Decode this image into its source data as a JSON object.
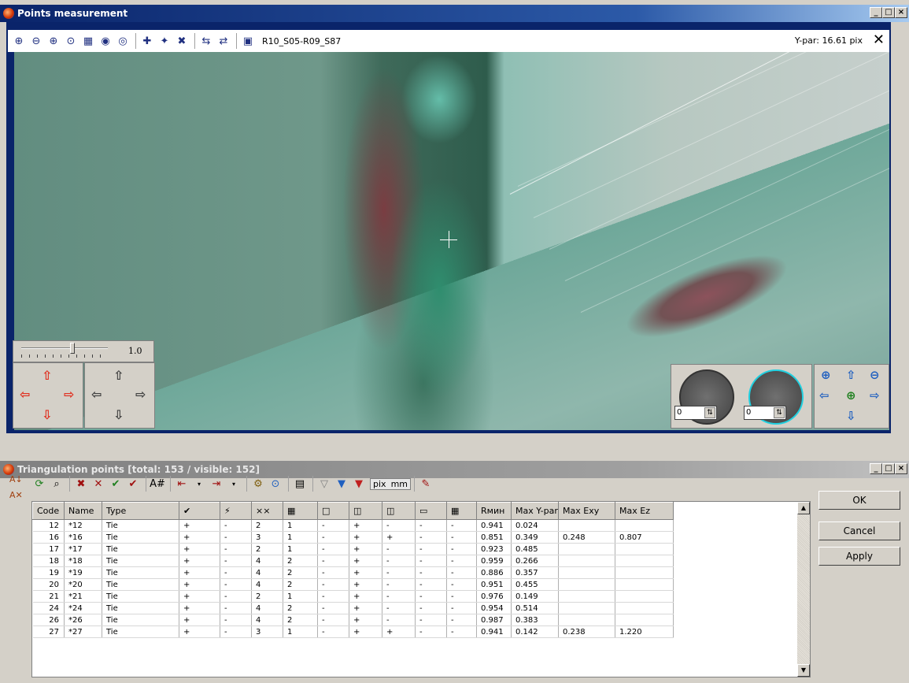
{
  "main_window": {
    "title": "Points measurement",
    "window_buttons": {
      "minimize": "_",
      "maximize": "□",
      "close": "×"
    }
  },
  "viewer": {
    "image_name": "R10_S05-R09_S87",
    "ypar_label": "Y-par: 16.61 pix",
    "close_label": "✕",
    "slider_value": "1.0",
    "rotation_left": "0",
    "rotation_right": "0"
  },
  "points_panel": {
    "title": "Triangulation points [total: 153 / visible: 152]",
    "units": [
      "pix",
      "mm"
    ],
    "columns": [
      "Code",
      "Name",
      "Type",
      "✔",
      "⚡",
      "××",
      "▦",
      "□",
      "◫",
      "◫",
      "▭",
      "▦",
      "Rмин",
      "Max Y-par",
      "Max Exy",
      "Max Ez"
    ],
    "rows": [
      [
        "12",
        "*12",
        "Tie",
        "+",
        "-",
        "2",
        "1",
        "-",
        "+",
        "-",
        "-",
        "-",
        "0.941",
        "0.024",
        "",
        ""
      ],
      [
        "16",
        "*16",
        "Tie",
        "+",
        "-",
        "3",
        "1",
        "-",
        "+",
        "+",
        "-",
        "-",
        "0.851",
        "0.349",
        "0.248",
        "0.807"
      ],
      [
        "17",
        "*17",
        "Tie",
        "+",
        "-",
        "2",
        "1",
        "-",
        "+",
        "-",
        "-",
        "-",
        "0.923",
        "0.485",
        "",
        ""
      ],
      [
        "18",
        "*18",
        "Tie",
        "+",
        "-",
        "4",
        "2",
        "-",
        "+",
        "-",
        "-",
        "-",
        "0.959",
        "0.266",
        "",
        ""
      ],
      [
        "19",
        "*19",
        "Tie",
        "+",
        "-",
        "4",
        "2",
        "-",
        "+",
        "-",
        "-",
        "-",
        "0.886",
        "0.357",
        "",
        ""
      ],
      [
        "20",
        "*20",
        "Tie",
        "+",
        "-",
        "4",
        "2",
        "-",
        "+",
        "-",
        "-",
        "-",
        "0.951",
        "0.455",
        "",
        ""
      ],
      [
        "21",
        "*21",
        "Tie",
        "+",
        "-",
        "2",
        "1",
        "-",
        "+",
        "-",
        "-",
        "-",
        "0.976",
        "0.149",
        "",
        ""
      ],
      [
        "24",
        "*24",
        "Tie",
        "+",
        "-",
        "4",
        "2",
        "-",
        "+",
        "-",
        "-",
        "-",
        "0.954",
        "0.514",
        "",
        ""
      ],
      [
        "26",
        "*26",
        "Tie",
        "+",
        "-",
        "4",
        "2",
        "-",
        "+",
        "-",
        "-",
        "-",
        "0.987",
        "0.383",
        "",
        ""
      ],
      [
        "27",
        "*27",
        "Tie",
        "+",
        "-",
        "3",
        "1",
        "-",
        "+",
        "+",
        "-",
        "-",
        "0.941",
        "0.142",
        "0.238",
        "1.220"
      ]
    ]
  },
  "buttons": {
    "ok": "OK",
    "cancel": "Cancel",
    "apply": "Apply"
  }
}
